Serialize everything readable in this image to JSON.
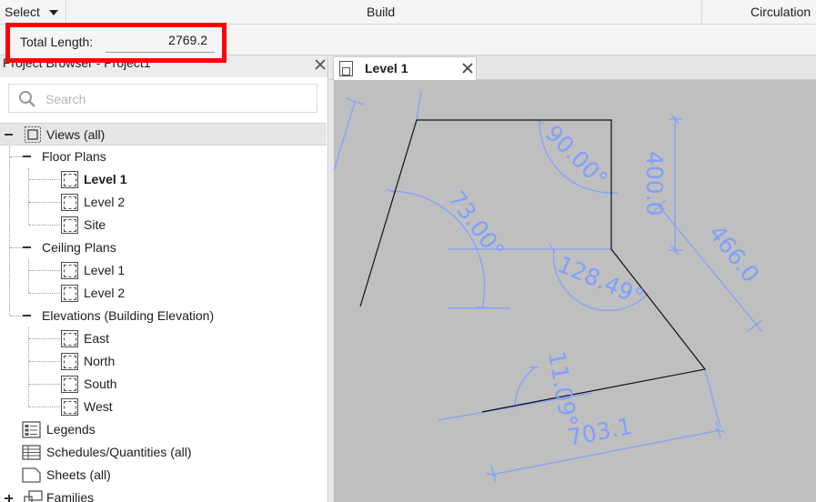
{
  "ribbon": {
    "select_label": "Select",
    "build_label": "Build",
    "circulation_label": "Circulation"
  },
  "options_bar": {
    "total_length_label": "Total Length:",
    "total_length_value": "2769.2",
    "highlight_color": "#ff0000"
  },
  "browser": {
    "title": "Project Browser - Project1",
    "search_placeholder": "Search",
    "views_label": "Views (all)",
    "floor_plans": {
      "label": "Floor Plans",
      "items": [
        "Level 1",
        "Level 2",
        "Site"
      ],
      "active": "Level 1"
    },
    "ceiling_plans": {
      "label": "Ceiling Plans",
      "items": [
        "Level 1",
        "Level 2"
      ]
    },
    "elevations": {
      "label": "Elevations (Building Elevation)",
      "items": [
        "East",
        "North",
        "South",
        "West"
      ]
    },
    "legends_label": "Legends",
    "schedules_label": "Schedules/Quantities (all)",
    "sheets_label": "Sheets (all)",
    "families_label": "Families"
  },
  "view_tab": {
    "label": "Level 1"
  },
  "drawing": {
    "dimension_color": "#7fa1ff",
    "canvas_color": "#bfbfbf",
    "angle_90": "90.00°",
    "angle_73": "73.00°",
    "angle_128": "128.49°",
    "angle_11": "11.09°",
    "length_400": "400.0",
    "length_466": "466.0",
    "length_703": "703.1"
  }
}
